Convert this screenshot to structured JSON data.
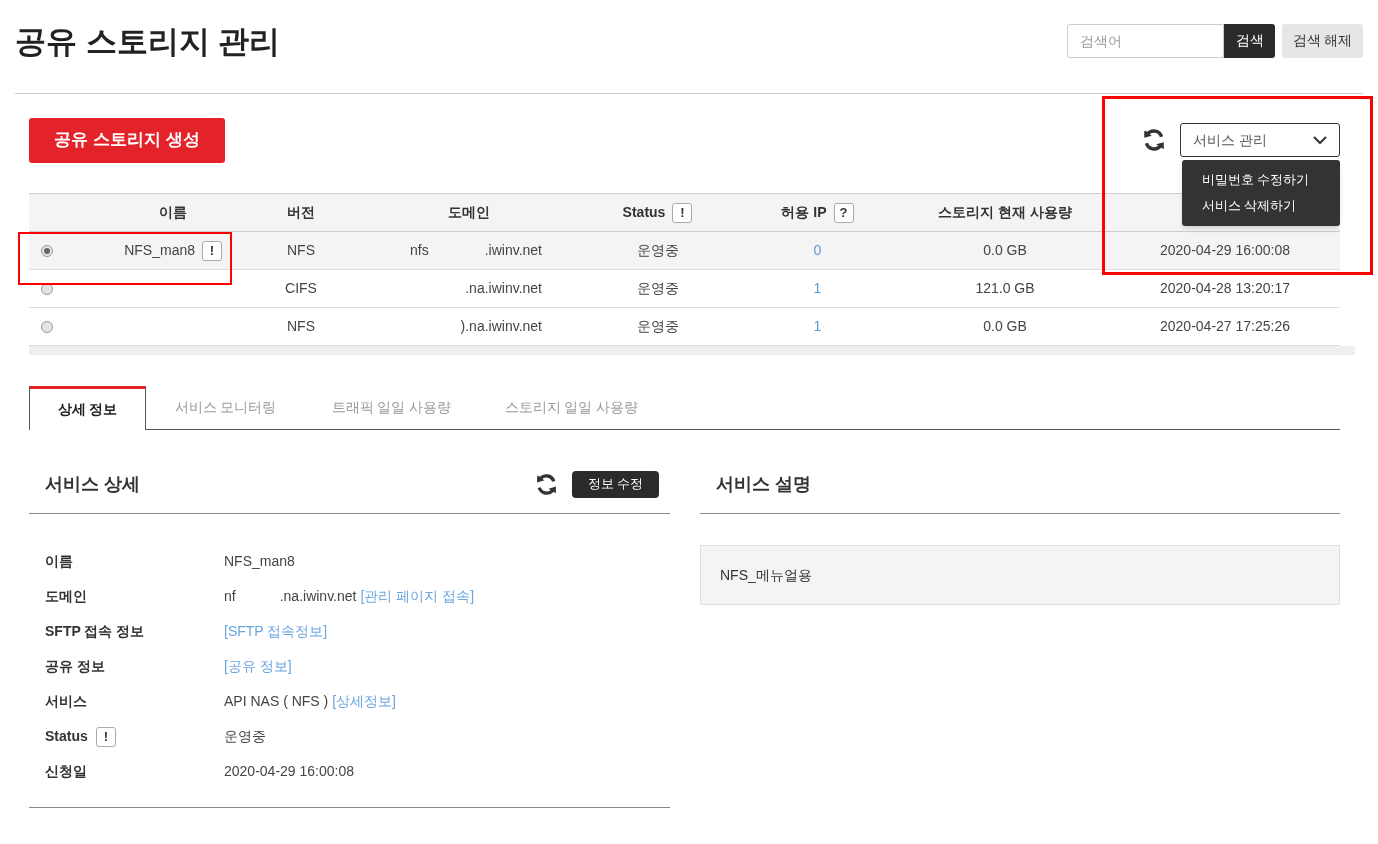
{
  "page_title": "공유 스토리지 관리",
  "search": {
    "placeholder": "검색어",
    "button": "검색",
    "clear_button": "검색 해제"
  },
  "create_button": "공유 스토리지 생성",
  "service_select": {
    "value": "서비스 관리",
    "expanded": true,
    "options": [
      "비밀번호 수정하기",
      "서비스 삭제하기"
    ]
  },
  "table": {
    "columns": [
      {
        "label": "이름"
      },
      {
        "label": "버전"
      },
      {
        "label": "도메인"
      },
      {
        "label": "Status",
        "badge": "!"
      },
      {
        "label": "허용 IP",
        "badge": "?"
      },
      {
        "label": "스토리지 현재 사용량"
      }
    ],
    "rows": [
      {
        "selected": true,
        "name": "NFS_man8",
        "name_badge": "!",
        "version": "NFS",
        "domain_prefix": "nfs",
        "domain": ".iwinv.net",
        "status": "운영중",
        "allowed_ip": "0",
        "usage": "0.0 GB",
        "date": "2020-04-29 16:00:08"
      },
      {
        "selected": false,
        "version": "CIFS",
        "domain": ".na.iwinv.net",
        "status": "운영중",
        "allowed_ip": "1",
        "usage": "121.0 GB",
        "date": "2020-04-28 13:20:17"
      },
      {
        "selected": false,
        "version": "NFS",
        "domain": ").na.iwinv.net",
        "status": "운영중",
        "allowed_ip": "1",
        "usage": "0.0 GB",
        "date": "2020-04-27 17:25:26"
      }
    ]
  },
  "tabs": [
    {
      "label": "상세 정보",
      "selected": true
    },
    {
      "label": "서비스 모니터링",
      "selected": false
    },
    {
      "label": "트래픽 일일 사용량",
      "selected": false
    },
    {
      "label": "스토리지 일일 사용량",
      "selected": false
    }
  ],
  "detail": {
    "title": "서비스 상세",
    "edit_button": "정보 수정",
    "rows": [
      {
        "label": "이름",
        "parts": [
          {
            "kind": "text",
            "text": "NFS_man8"
          }
        ]
      },
      {
        "label": "도메인",
        "parts": [
          {
            "kind": "text",
            "text": "nf"
          },
          {
            "kind": "text",
            "text": ".na.iwinv.net"
          },
          {
            "kind": "link",
            "text": "[관리 페이지 접속]"
          }
        ]
      },
      {
        "label": "SFTP 접속 정보",
        "parts": [
          {
            "kind": "link",
            "text": "[SFTP 접속정보]"
          }
        ]
      },
      {
        "label": "공유 정보",
        "parts": [
          {
            "kind": "link",
            "text": "[공유 정보]"
          }
        ]
      },
      {
        "label": "서비스",
        "parts": [
          {
            "kind": "text",
            "text": "API NAS ( NFS )"
          },
          {
            "kind": "link",
            "text": "[상세정보]"
          }
        ]
      },
      {
        "label": "Status",
        "badge": "!",
        "parts": [
          {
            "kind": "text",
            "text": "운영중"
          }
        ]
      },
      {
        "label": "신청일",
        "parts": [
          {
            "kind": "text",
            "text": "2020-04-29 16:00:08"
          }
        ]
      }
    ]
  },
  "description": {
    "title": "서비스 설명",
    "text": "NFS_메뉴얼용"
  }
}
